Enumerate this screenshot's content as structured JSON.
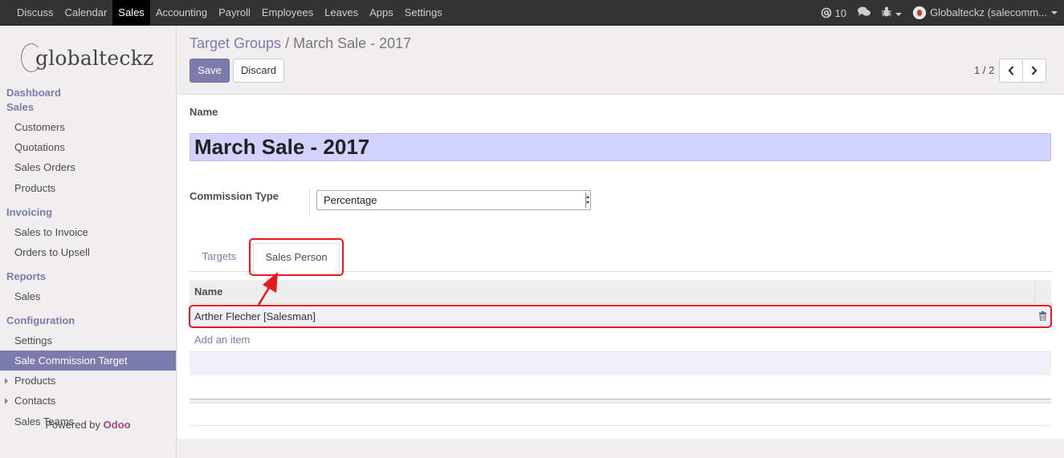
{
  "topbar": {
    "menu": [
      "Discuss",
      "Calendar",
      "Sales",
      "Accounting",
      "Payroll",
      "Employees",
      "Leaves",
      "Apps",
      "Settings"
    ],
    "active_menu": "Sales",
    "mentions_count": "10",
    "user_label": "Globalteckz (salecomm..."
  },
  "sidebar": {
    "logo_text": "globalteckz",
    "sections": {
      "dashboard": "Dashboard",
      "sales": "Sales",
      "invoicing": "Invoicing",
      "reports": "Reports",
      "configuration": "Configuration"
    },
    "items": {
      "customers": "Customers",
      "quotations": "Quotations",
      "sales_orders": "Sales Orders",
      "products": "Products",
      "sales_to_invoice": "Sales to Invoice",
      "orders_to_upsell": "Orders to Upsell",
      "reports_sales": "Sales",
      "settings": "Settings",
      "sale_commission_target": "Sale Commission Target",
      "config_products": "Products",
      "contacts": "Contacts",
      "sales_teams": "Sales Teams"
    },
    "powered_by": "Powered by",
    "powered_brand": "Odoo"
  },
  "breadcrumb": {
    "parent": "Target Groups",
    "separator": "/",
    "current": "March Sale - 2017"
  },
  "buttons": {
    "save": "Save",
    "discard": "Discard"
  },
  "pager": {
    "text": "1 / 2"
  },
  "form": {
    "name_label": "Name",
    "name_value": "March Sale - 2017",
    "commission_type_label": "Commission Type",
    "commission_type_value": "Percentage"
  },
  "tabs": {
    "targets": "Targets",
    "sales_person": "Sales Person",
    "active": "Sales Person"
  },
  "table": {
    "header_name": "Name",
    "rows": [
      "Arther Flecher [Salesman]"
    ],
    "add_item": "Add an item"
  },
  "colors": {
    "accent": "#7c7bad",
    "highlight": "#e8191c",
    "brand": "#a24689"
  }
}
